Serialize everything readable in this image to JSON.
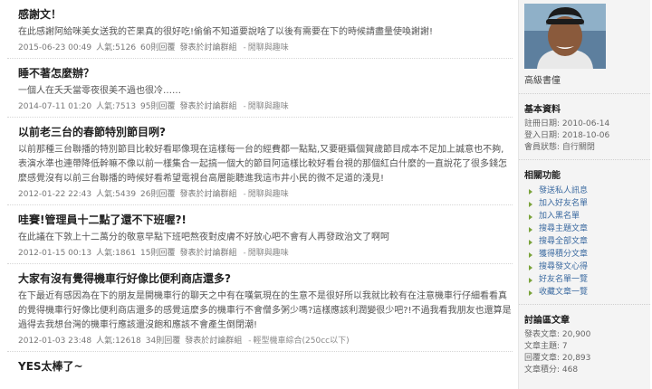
{
  "posts": [
    {
      "title": "感謝文！",
      "body": "在此感謝阿給咪美女送我的芒果真的很好吃!偷偷不知道要說啥了以後有需要在下的時候請盡量使喚謝謝!",
      "date": "2015-06-23 00:49",
      "views": "人氣:5126",
      "replies": "60則回覆",
      "group": "發表於討論群組",
      "category": "閒聊與趣味"
    },
    {
      "title": "睡不著怎麼辦？",
      "body": "一個人在夭夭當零夜很美不過也很冷……",
      "date": "2014-07-11 01:20",
      "views": "人氣:7513",
      "replies": "95則回覆",
      "group": "發表於討論群組",
      "category": "閒聊與趣味"
    },
    {
      "title": "以前老三台的春節特別節目咧?",
      "body": "以前那種三台聯播的特別節目比較好看耶像現在這樣每一台的經費都一點點,又要砸攝個賀歲節目成本不足加上誠意也不夠,表演水準也連帶降低幹嘛不像以前一樣集合一起搞一個大的節目阿這樣比較好看台視的那個紅白什麼的一直說花了很多錢怎麼感覺沒有以前三台聯播的時候好看希望電視台高層能聽進我這市井小民的微不足道的淺見!",
      "date": "2012-01-22 22:43",
      "views": "人氣:5439",
      "replies": "26則回覆",
      "group": "發表於討論群組",
      "category": "閒聊與趣味"
    },
    {
      "title": "哇賽!管理員十二點了還不下班喔?!",
      "body": "在此議在下敦上十二萬分的敬意早點下班吧熬夜對皮膚不好放心吧不會有人再發政治文了啊呵",
      "date": "2012-01-15 00:13",
      "views": "人氣:1861",
      "replies": "15則回覆",
      "group": "發表於討論群組",
      "category": "閒聊與趣味"
    },
    {
      "title": "大家有沒有覺得機車行好像比便利商店還多?",
      "body": "在下最近有感因為在下的朋友是開機車行的聊天之中有在嘆氣現在的生意不是很好所以我就比較有在注意機車行仔細看看真的覺得機車行好像比便利商店還多的感覺這麼多的機車行不會僧多粥少嗎?這樣應該利潤變很少吧?!不過我看我朋友也還算是過得去我想台灣的機車行應該還沒飽和應該不會產生倒閉潮!",
      "date": "2012-01-03 23:48",
      "views": "人氣:12618",
      "replies": "34則回覆",
      "group": "發表於討論群組",
      "category": "輕型機車綜合(250cc以下)"
    },
    {
      "title": "YES太棒了~"
    }
  ],
  "sidebar": {
    "username": "高級書僮",
    "basic_title": "基本資料",
    "basic": [
      "註冊日期: 2010-06-14",
      "登入日期: 2018-10-06",
      "會員狀態: 自行關閉"
    ],
    "func_title": "相關功能",
    "functions": [
      "發送私人訊息",
      "加入好友名單",
      "加入黑名單",
      "搜尋主題文章",
      "搜尋全部文章",
      "獲得積分文章",
      "搜尋發文心得",
      "好友名單一覽",
      "收藏文章一覽"
    ],
    "stats_title": "討論區文章",
    "stats": [
      "發表文章: 20,900",
      "文章主題: 7",
      "回覆文章: 20,893",
      "文章積分: 468"
    ]
  }
}
